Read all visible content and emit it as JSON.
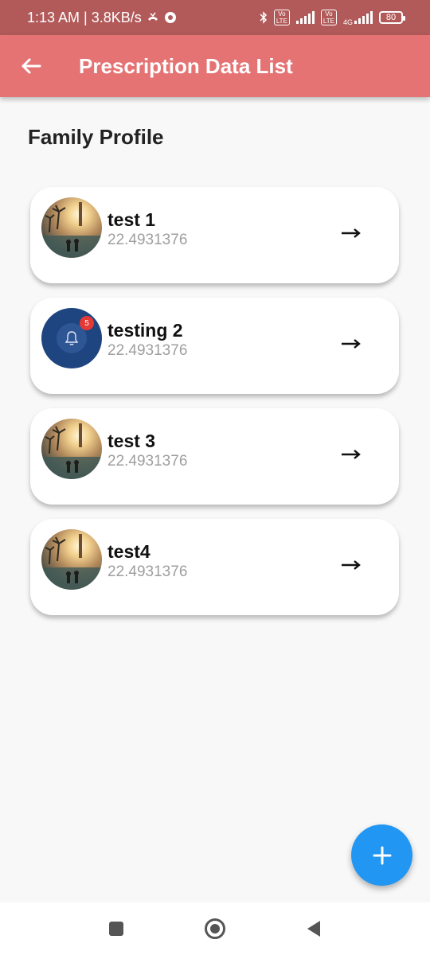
{
  "status_bar": {
    "time": "1:13 AM | 3.8KB/s",
    "network_label": "4G",
    "battery": "80"
  },
  "app_bar": {
    "title": "Prescription Data List"
  },
  "section": {
    "title": "Family Profile"
  },
  "profiles": [
    {
      "name": "test 1",
      "value": "22.4931376",
      "avatar": "photo"
    },
    {
      "name": "testing 2",
      "value": "22.4931376",
      "avatar": "bell-icon",
      "badge": "5"
    },
    {
      "name": "test 3",
      "value": "22.4931376",
      "avatar": "photo"
    },
    {
      "name": "test4",
      "value": "22.4931376",
      "avatar": "photo"
    }
  ],
  "colors": {
    "status_bar": "#b25a5a",
    "app_bar": "#e57373",
    "fab": "#2196f3",
    "background": "#f8f8f8"
  }
}
